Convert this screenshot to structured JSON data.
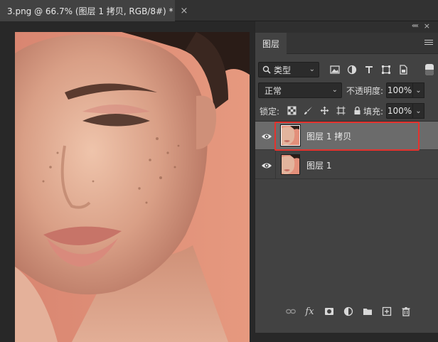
{
  "document_tab": {
    "title": "3.png @ 66.7% (图层 1 拷贝, RGB/8#) *",
    "close": "×"
  },
  "panel": {
    "collapse_glyph": "««",
    "close_glyph": "×",
    "tab_label": "图层",
    "filter": {
      "kind_label": "类型",
      "caret": "⌄"
    },
    "blend": {
      "mode": "正常",
      "caret": "⌄"
    },
    "opacity": {
      "label": "不透明度:",
      "value": "100%",
      "caret": "⌄"
    },
    "lock": {
      "label": "锁定:"
    },
    "fill": {
      "label": "填充:",
      "value": "100%",
      "caret": "⌄"
    },
    "layers": [
      {
        "name": "图层 1 拷贝",
        "selected": true,
        "visible": true
      },
      {
        "name": "图层 1",
        "selected": false,
        "visible": true
      }
    ],
    "footer": {
      "fx_label": "fx"
    }
  },
  "colors": {
    "accent_selection_outline": "#e5322d",
    "panel_bg": "#424242",
    "selected_row": "#6b6b6b",
    "canvas_bg": "#e0907a"
  }
}
